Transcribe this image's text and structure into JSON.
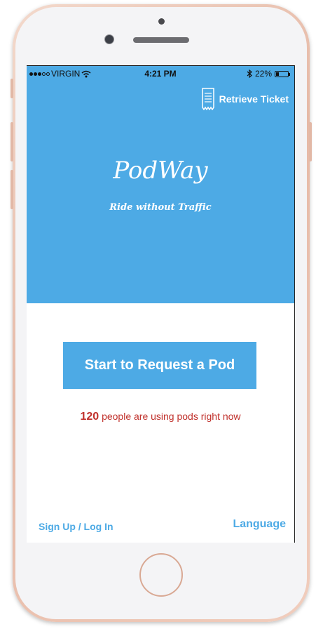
{
  "status_bar": {
    "carrier": "VIRGIN",
    "time": "4:21 PM",
    "battery": "22%",
    "battery_level": 0.22
  },
  "header": {
    "retrieve_label": "Retrieve Ticket",
    "retrieve_icon": "ticket-icon"
  },
  "hero": {
    "app_name": "PodWay",
    "tagline": "Ride without Traffic"
  },
  "main": {
    "request_label": "Start to Request a Pod",
    "active_count": "120",
    "active_text": "people are using pods right now"
  },
  "footer": {
    "signup_label": "Sign Up / Log In",
    "language_label": "Language"
  },
  "colors": {
    "accent": "#4daae5",
    "highlight": "#c0302b"
  }
}
